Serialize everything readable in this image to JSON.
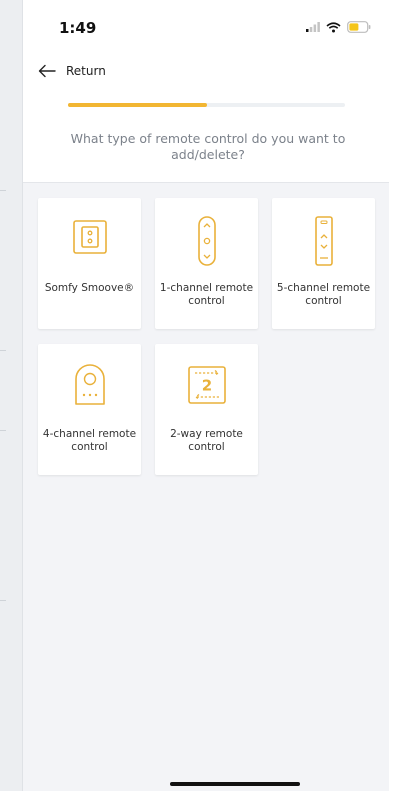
{
  "status": {
    "time": "1:49"
  },
  "nav": {
    "return_label": "Return"
  },
  "wizard": {
    "progress": 0.5,
    "question": "What type of remote control do you want to add/delete?"
  },
  "remote_types": [
    {
      "label": "Somfy Smoove®",
      "icon": "smoove-switch-icon"
    },
    {
      "label": "1-channel remote control",
      "icon": "one-channel-remote-icon"
    },
    {
      "label": "5-channel remote control",
      "icon": "five-channel-remote-icon"
    },
    {
      "label": "4-channel remote control",
      "icon": "four-channel-remote-icon"
    },
    {
      "label": "2-way remote control",
      "icon": "two-way-remote-icon"
    }
  ],
  "colors": {
    "accent": "#f2b632",
    "icon_stroke": "#e9b13a"
  }
}
